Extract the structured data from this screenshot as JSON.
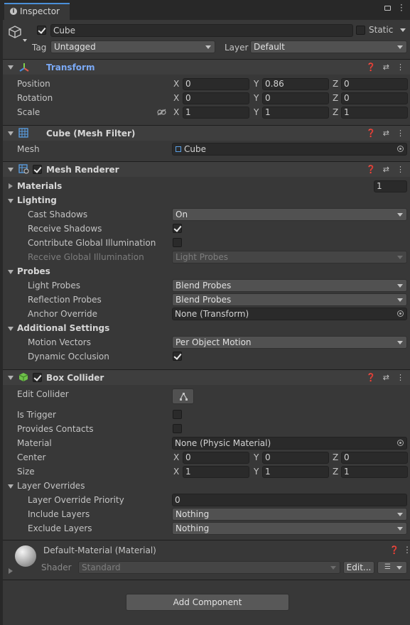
{
  "window": {
    "tab_title": "Inspector"
  },
  "object": {
    "name": "Cube",
    "static_label": "Static",
    "tag_label": "Tag",
    "tag_value": "Untagged",
    "layer_label": "Layer",
    "layer_value": "Default"
  },
  "transform": {
    "title": "Transform",
    "position": {
      "label": "Position",
      "x": "0",
      "y": "0.86",
      "z": "0"
    },
    "rotation": {
      "label": "Rotation",
      "x": "0",
      "y": "0",
      "z": "0"
    },
    "scale": {
      "label": "Scale",
      "x": "1",
      "y": "1",
      "z": "1"
    }
  },
  "axes": {
    "x": "X",
    "y": "Y",
    "z": "Z"
  },
  "mesh_filter": {
    "title": "Cube (Mesh Filter)",
    "mesh_label": "Mesh",
    "mesh_value": "Cube"
  },
  "mesh_renderer": {
    "title": "Mesh Renderer",
    "materials_label": "Materials",
    "materials_count": "1",
    "lighting_label": "Lighting",
    "cast_shadows_label": "Cast Shadows",
    "cast_shadows_value": "On",
    "receive_shadows_label": "Receive Shadows",
    "contribute_gi_label": "Contribute Global Illumination",
    "receive_gi_label": "Receive Global Illumination",
    "receive_gi_value": "Light Probes",
    "probes_label": "Probes",
    "light_probes_label": "Light Probes",
    "light_probes_value": "Blend Probes",
    "reflection_probes_label": "Reflection Probes",
    "reflection_probes_value": "Blend Probes",
    "anchor_override_label": "Anchor Override",
    "anchor_override_value": "None (Transform)",
    "additional_label": "Additional Settings",
    "motion_vectors_label": "Motion Vectors",
    "motion_vectors_value": "Per Object Motion",
    "dynamic_occlusion_label": "Dynamic Occlusion"
  },
  "box_collider": {
    "title": "Box Collider",
    "edit_collider_label": "Edit Collider",
    "is_trigger_label": "Is Trigger",
    "provides_contacts_label": "Provides Contacts",
    "material_label": "Material",
    "material_value": "None (Physic Material)",
    "center": {
      "label": "Center",
      "x": "0",
      "y": "0",
      "z": "0"
    },
    "size": {
      "label": "Size",
      "x": "1",
      "y": "1",
      "z": "1"
    },
    "layer_overrides_label": "Layer Overrides",
    "priority_label": "Layer Override Priority",
    "priority_value": "0",
    "include_label": "Include Layers",
    "include_value": "Nothing",
    "exclude_label": "Exclude Layers",
    "exclude_value": "Nothing"
  },
  "material": {
    "title": "Default-Material (Material)",
    "shader_label": "Shader",
    "shader_value": "Standard",
    "edit_label": "Edit..."
  },
  "add_component_label": "Add Component",
  "colors": {
    "background": "#383838",
    "header": "#3e3e3e",
    "field": "#2a2a2a",
    "accent_transform": "#7baaf7"
  }
}
